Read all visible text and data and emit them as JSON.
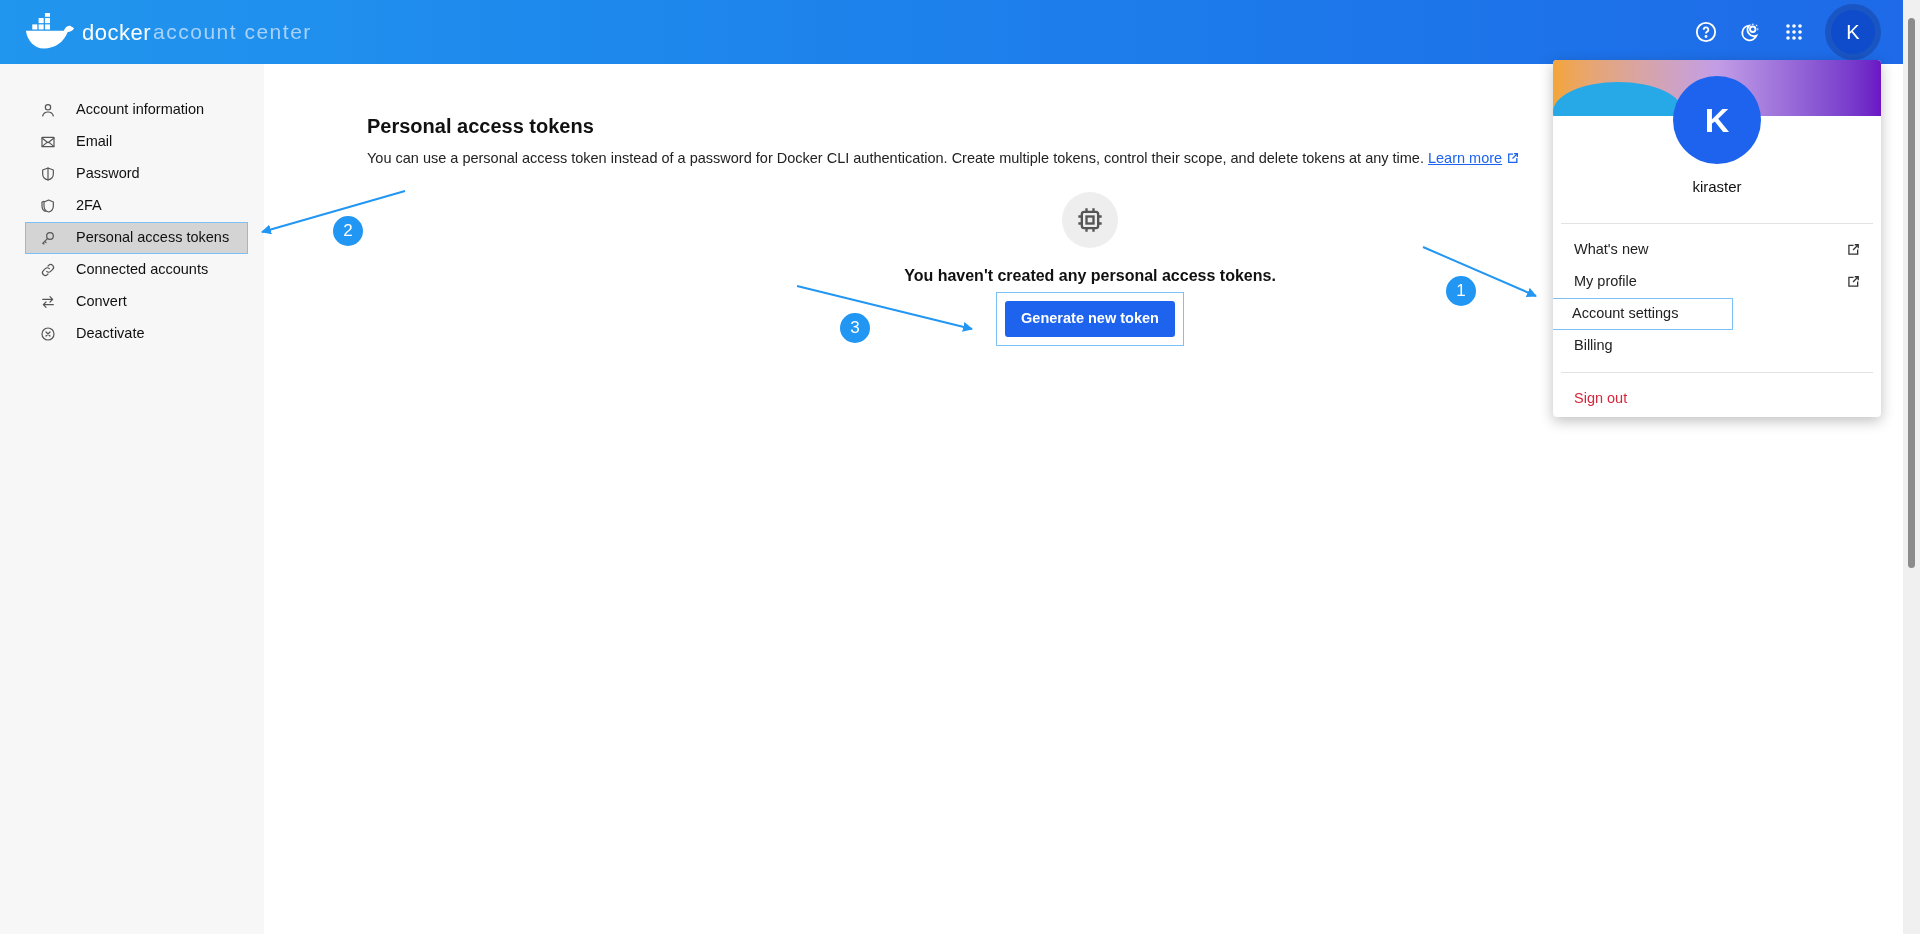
{
  "header": {
    "logo_brand": "docker",
    "logo_product": "account center",
    "avatar_initial": "K"
  },
  "sidebar": {
    "items": [
      {
        "label": "Account information",
        "selected": false,
        "highlighted": false
      },
      {
        "label": "Email",
        "selected": false,
        "highlighted": false
      },
      {
        "label": "Password",
        "selected": false,
        "highlighted": false
      },
      {
        "label": "2FA",
        "selected": false,
        "highlighted": false
      },
      {
        "label": "Personal access tokens",
        "selected": true,
        "highlighted": true
      },
      {
        "label": "Connected accounts",
        "selected": false,
        "highlighted": false
      },
      {
        "label": "Convert",
        "selected": false,
        "highlighted": false
      },
      {
        "label": "Deactivate",
        "selected": false,
        "highlighted": false
      }
    ]
  },
  "main": {
    "title": "Personal access tokens",
    "description": "You can use a personal access token instead of a password for Docker CLI authentication. Create multiple tokens, control their scope, and delete tokens at any time.",
    "learn_more": "Learn more",
    "empty_message": "You haven't created any personal access tokens.",
    "button": {
      "label": "Generate new token",
      "highlighted": true
    }
  },
  "profile_menu": {
    "avatar_initial": "K",
    "username": "kiraster",
    "items": [
      {
        "label": "What's new",
        "external": true,
        "highlighted": false,
        "danger": false
      },
      {
        "label": "My profile",
        "external": true,
        "highlighted": false,
        "danger": false
      },
      {
        "label": "Account settings",
        "external": false,
        "highlighted": true,
        "danger": false
      },
      {
        "label": "Billing",
        "external": false,
        "highlighted": false,
        "danger": false
      },
      {
        "label": "Sign out",
        "external": false,
        "highlighted": false,
        "danger": true
      }
    ]
  },
  "annotations": [
    {
      "label": "1"
    },
    {
      "label": "2"
    },
    {
      "label": "3"
    }
  ]
}
